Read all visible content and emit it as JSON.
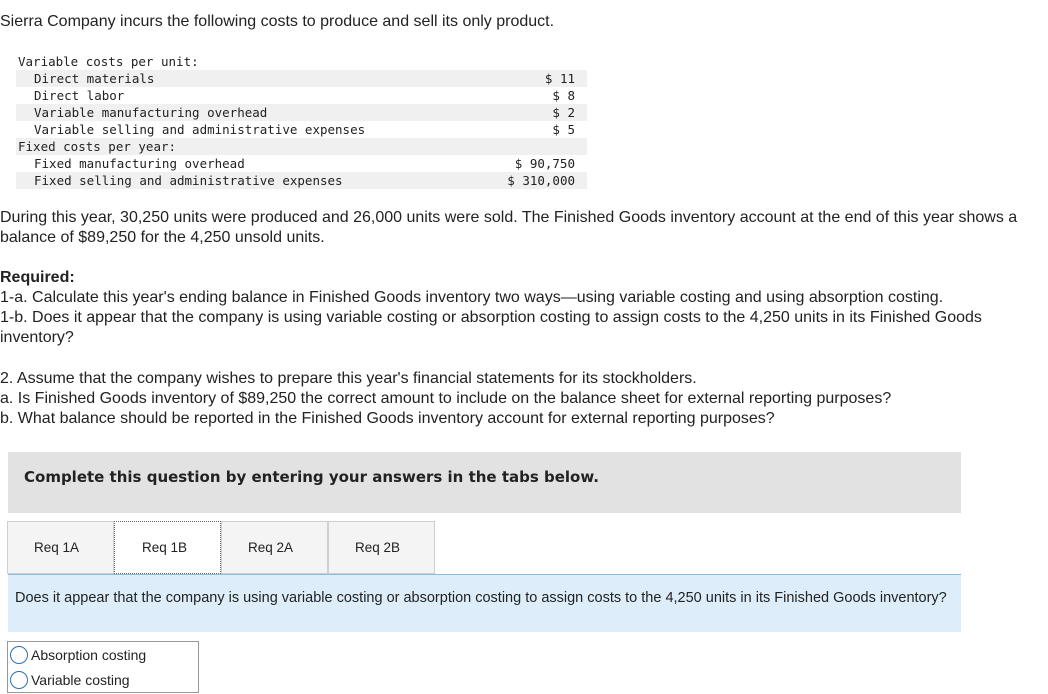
{
  "intro": "Sierra Company incurs the following costs to produce and sell its only product.",
  "costs": [
    {
      "label": "Variable costs per unit:",
      "amount": "",
      "level": 0,
      "shaded": false
    },
    {
      "label": "Direct materials",
      "amount": "$ 11",
      "level": 1,
      "shaded": true
    },
    {
      "label": "Direct labor",
      "amount": "$ 8",
      "level": 1,
      "shaded": false
    },
    {
      "label": "Variable manufacturing overhead",
      "amount": "$ 2",
      "level": 1,
      "shaded": true
    },
    {
      "label": "Variable selling and administrative expenses",
      "amount": "$ 5",
      "level": 1,
      "shaded": false
    },
    {
      "label": "Fixed costs per year:",
      "amount": "",
      "level": 0,
      "shaded": true
    },
    {
      "label": "Fixed manufacturing overhead",
      "amount": "$ 90,750",
      "level": 1,
      "shaded": false
    },
    {
      "label": "Fixed selling and administrative expenses",
      "amount": "$ 310,000",
      "level": 1,
      "shaded": true
    }
  ],
  "paragraph": "During this year, 30,250 units were produced and 26,000 units were sold. The Finished Goods inventory account at the end of this year shows a balance of $89,250 for the 4,250 unsold units.",
  "required": {
    "heading": "Required:",
    "item_1a": "1-a. Calculate this year's ending balance in Finished Goods inventory two ways—using variable costing and using absorption costing.",
    "item_1b": "1-b. Does it appear that the company is using variable costing or absorption costing to assign costs to the 4,250 units in its Finished Goods inventory?",
    "item_2": "2. Assume that the company wishes to prepare this year's financial statements for its stockholders.",
    "item_2a": "a. Is Finished Goods inventory of $89,250 the correct amount to include on the balance sheet for external reporting purposes?",
    "item_2b": "b. What balance should be reported in the Finished Goods inventory account for external reporting purposes?"
  },
  "banner": "Complete this question by entering your answers in the tabs below.",
  "tabs": [
    {
      "label": "Req 1A",
      "active": false
    },
    {
      "label": "Req 1B",
      "active": true
    },
    {
      "label": "Req 2A",
      "active": false
    },
    {
      "label": "Req 2B",
      "active": false
    }
  ],
  "question": "Does it appear that the company is using variable costing or absorption costing to assign costs to the 4,250 units in its Finished Goods inventory?",
  "options": [
    "Absorption costing",
    "Variable costing"
  ]
}
